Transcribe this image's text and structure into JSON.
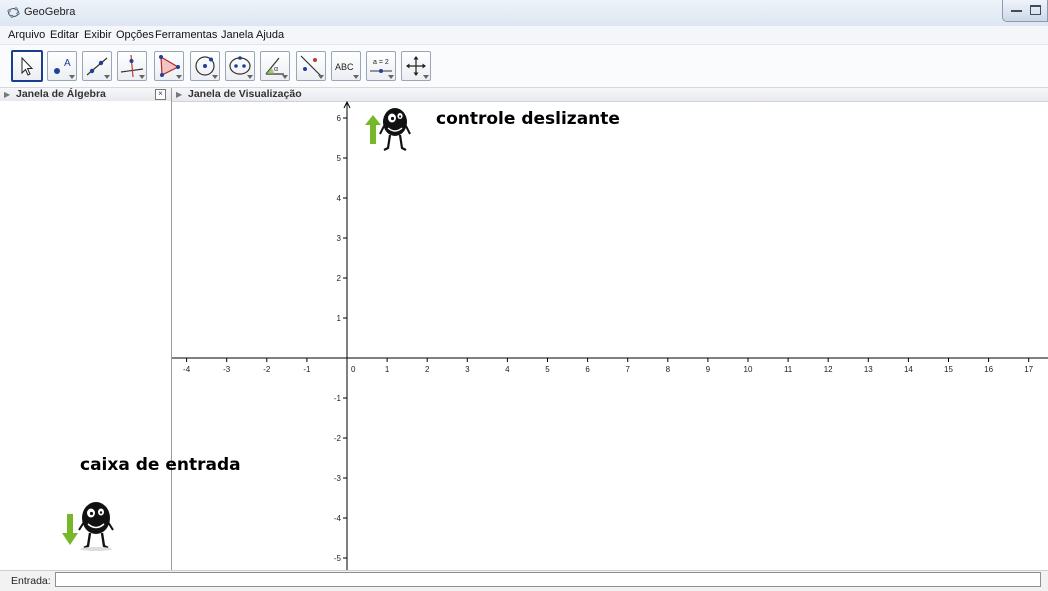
{
  "window": {
    "title": "GeoGebra",
    "app_icon": "geogebra-logo-icon"
  },
  "menu": {
    "items": [
      "Arquivo",
      "Editar",
      "Exibir",
      "Opções",
      "Ferramentas",
      "Janela",
      "Ajuda"
    ]
  },
  "toolbar": {
    "tools": [
      {
        "name": "move-tool",
        "icon": "arrow-pointer-icon",
        "selected": true
      },
      {
        "name": "point-tool",
        "icon": "point-A-icon"
      },
      {
        "name": "line-tool",
        "icon": "line-through-points-icon"
      },
      {
        "name": "perpendicular-tool",
        "icon": "perpendicular-line-icon"
      },
      {
        "name": "polygon-tool",
        "icon": "polygon-icon"
      },
      {
        "name": "circle-tool",
        "icon": "circle-center-point-icon"
      },
      {
        "name": "conic-tool",
        "icon": "ellipse-icon"
      },
      {
        "name": "angle-tool",
        "icon": "angle-icon"
      },
      {
        "name": "reflect-tool",
        "icon": "reflect-about-line-icon"
      },
      {
        "name": "text-tool",
        "icon": "text-icon",
        "label": "ABC"
      },
      {
        "name": "slider-tool",
        "icon": "slider-icon",
        "label": "a = 2"
      },
      {
        "name": "move-view-tool",
        "icon": "move-graphics-view-icon"
      }
    ]
  },
  "panels": {
    "algebra": {
      "title": "Janela de Álgebra",
      "close": "×"
    },
    "graphics": {
      "title": "Janela de Visualização"
    }
  },
  "graph": {
    "x_ticks": [
      "-4",
      "-3",
      "-2",
      "-1",
      "0",
      "1",
      "2",
      "3",
      "4",
      "5",
      "6",
      "7",
      "8",
      "9",
      "10",
      "11",
      "12",
      "13",
      "14",
      "15",
      "16",
      "17"
    ],
    "y_ticks_pos": [
      "6",
      "5",
      "4",
      "3",
      "2",
      "1"
    ],
    "y_ticks_neg": [
      "-1",
      "-2",
      "-3",
      "-4",
      "-5"
    ],
    "x_range": [
      -4.3,
      17.6
    ],
    "y_range": [
      -5.4,
      6.2
    ]
  },
  "annotations": {
    "slider_label": "controle deslizante",
    "input_label": "caixa de entrada"
  },
  "colors": {
    "arrow": "#76b82a",
    "mascot": "#111111",
    "toolbar_selected": "#1b3f8c"
  },
  "input_bar": {
    "label": "Entrada:",
    "value": ""
  }
}
